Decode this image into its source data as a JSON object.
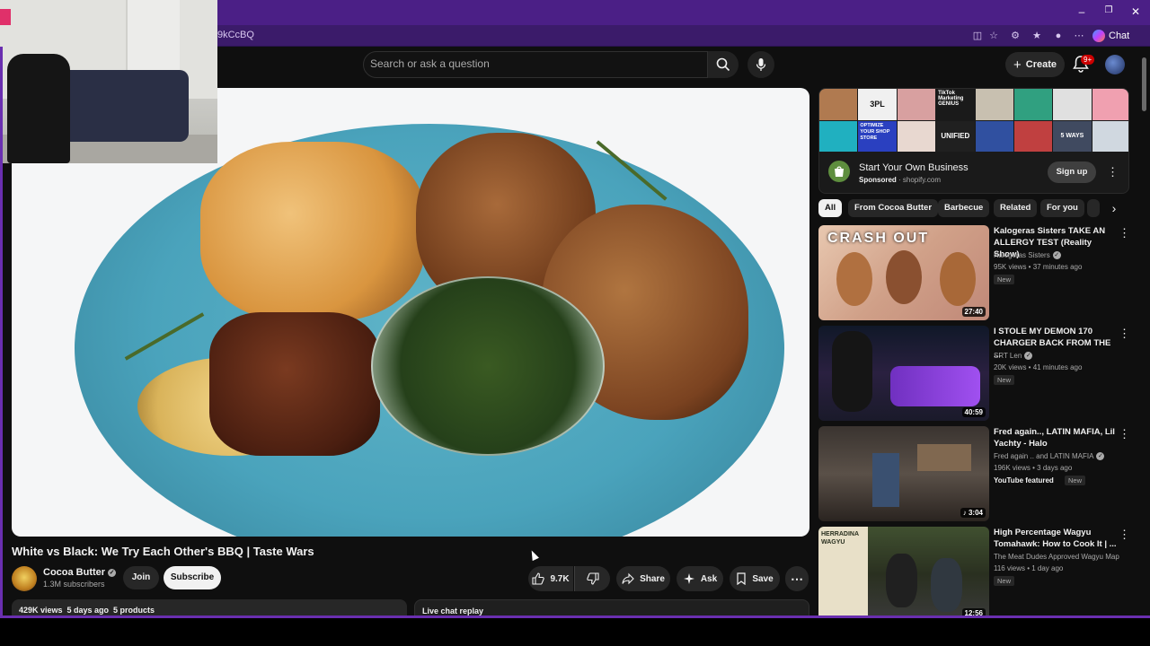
{
  "browser": {
    "url_fragment": "9kCcBQ",
    "chat_label": "Chat"
  },
  "masthead": {
    "search_placeholder": "Search or ask a question",
    "create_label": "Create",
    "notif_count": "9+"
  },
  "video": {
    "title": "White vs Black: We Try Each Other's BBQ | Taste Wars",
    "channel": "Cocoa Butter",
    "subscribers": "1.3M subscribers",
    "join_label": "Join",
    "subscribe_label": "Subscribe",
    "likes": "9.7K",
    "share_label": "Share",
    "ask_label": "Ask",
    "save_label": "Save",
    "views_meta": "429K views  5 days ago  5 products",
    "live_chat_label": "Live chat replay"
  },
  "ad": {
    "title": "Start Your Own Business",
    "sponsored": "Sponsored",
    "domain": "shopify.com",
    "cta": "Sign up",
    "collage_text": [
      "3PL",
      "TikTok Marketing GENIUS",
      "OPTIMIZE YOUR SHOP STORE",
      "UNIFIED",
      "5 WAYS"
    ]
  },
  "chips": [
    "All",
    "From Cocoa Butter",
    "Barbecue",
    "Related",
    "For you"
  ],
  "recommendations": [
    {
      "title": "Kalogeras Sisters TAKE AN ALLERGY TEST (Reality Show)",
      "channel": "Kalogeras Sisters",
      "meta": "95K views • 37 minutes ago",
      "badge": "New",
      "duration": "27:40",
      "thumb_text": "CRASH OUT"
    },
    {
      "title": "I STOLE MY DEMON 170 CHARGER BACK FROM THE ...",
      "channel": "SRT Len",
      "meta": "20K views • 41 minutes ago",
      "badge": "New",
      "duration": "40:59"
    },
    {
      "title": "Fred again.., LATIN MAFIA, Lil Yachty - Halo",
      "channel": "Fred again .. and LATIN MAFIA",
      "meta": "196K views • 3 days ago",
      "featured": "YouTube featured",
      "badge": "New",
      "duration": "3:04"
    },
    {
      "title": "High Percentage Wagyu Tomahawk: How to Cook It | ...",
      "channel": "The Meat Dudes Approved Wagyu Map",
      "meta": "116 views • 1 day ago",
      "badge": "New",
      "duration": "12:56",
      "thumb_text": "HERRADINA WAGYU"
    }
  ]
}
